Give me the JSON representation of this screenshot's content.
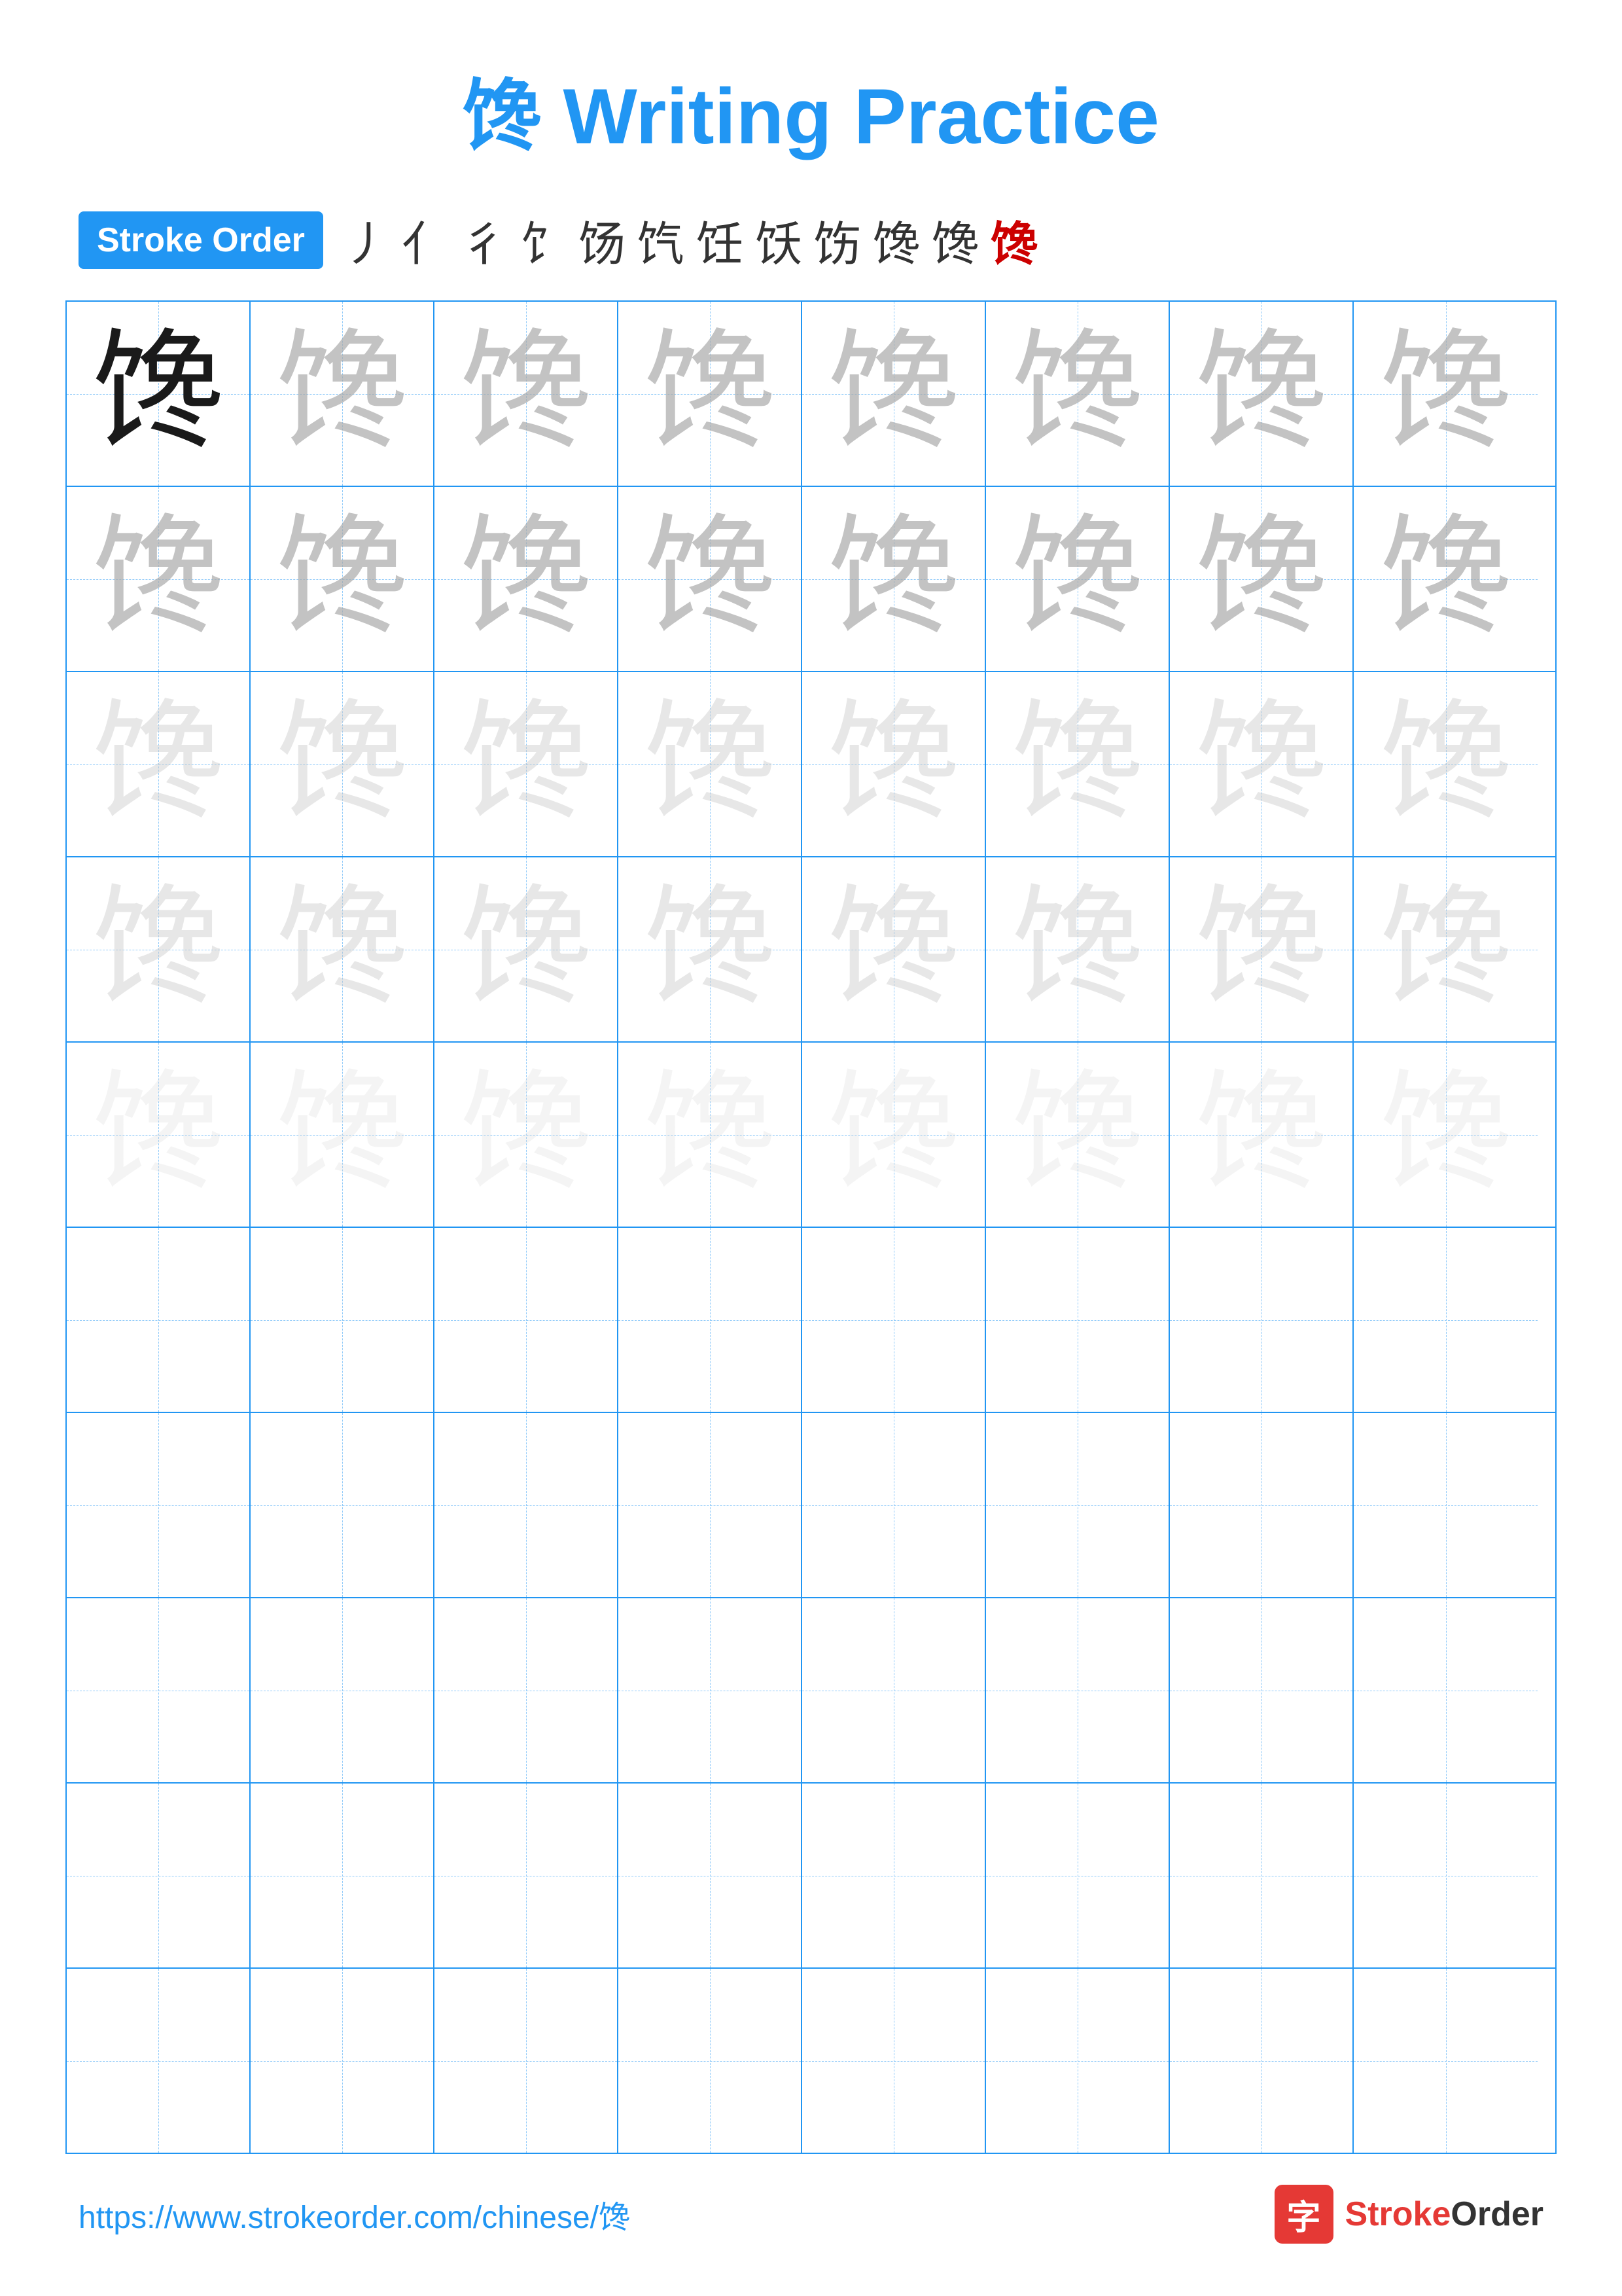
{
  "page": {
    "title": "馋 Writing Practice",
    "character": "馋",
    "stroke_order_label": "Stroke Order",
    "stroke_order_chars": [
      "丿",
      "亻",
      "彳",
      "饣",
      "饣",
      "饣",
      "饣",
      "饣",
      "饣",
      "馋",
      "馋",
      "馋"
    ],
    "url": "https://www.strokeorder.com/chinese/馋",
    "logo_char": "字",
    "logo_text": "StrokeOrder",
    "rows": 10,
    "cols": 8,
    "practice_rows": [
      {
        "opacity": "dark",
        "count": 8
      },
      {
        "opacity": "medium",
        "count": 8
      },
      {
        "opacity": "medium",
        "count": 8
      },
      {
        "opacity": "light",
        "count": 8
      },
      {
        "opacity": "very-light",
        "count": 8
      },
      {
        "opacity": "empty",
        "count": 8
      },
      {
        "opacity": "empty",
        "count": 8
      },
      {
        "opacity": "empty",
        "count": 8
      },
      {
        "opacity": "empty",
        "count": 8
      },
      {
        "opacity": "empty",
        "count": 8
      }
    ]
  }
}
